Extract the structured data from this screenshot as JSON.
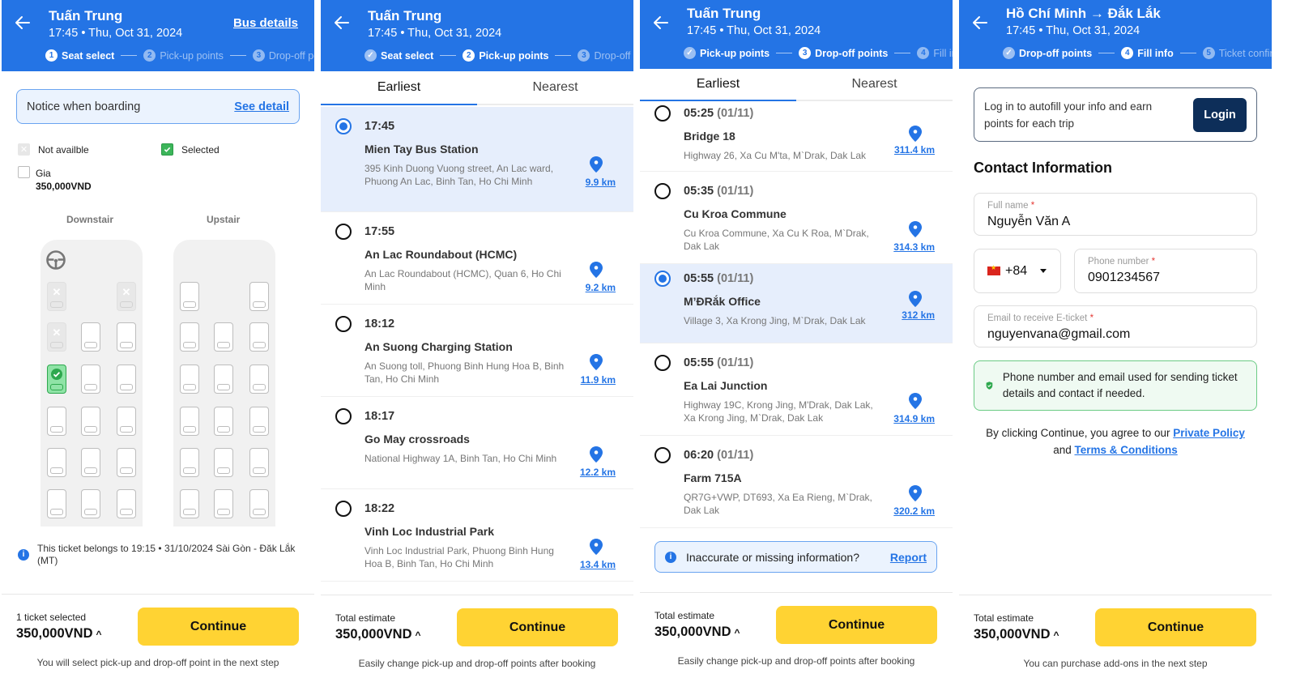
{
  "colors": {
    "brand_blue": "#2474e5",
    "continue_yellow": "#ffd333",
    "login_navy": "#0d2e59",
    "selected_green": "#2ea84e"
  },
  "panel1": {
    "header": {
      "title": "Tuấn Trung",
      "subtitle": "17:45 • Thu, Oct 31, 2024",
      "link": "Bus details"
    },
    "steps": [
      {
        "num": "1",
        "label": "Seat select",
        "state": "active"
      },
      {
        "num": "2",
        "label": "Pick-up points",
        "state": "pending"
      },
      {
        "num": "3",
        "label": "Drop-off points",
        "state": "pending"
      }
    ],
    "notice": {
      "text": "Notice when boarding",
      "link": "See detail"
    },
    "legend": {
      "not_available": "Not availble",
      "selected": "Selected",
      "price_label": "Gia",
      "price": "350,000VND"
    },
    "decks": {
      "downstair": "Downstair",
      "upstair": "Upstair"
    },
    "seat_map": {
      "downstair": [
        [
          "na",
          "",
          "na"
        ],
        [
          "na",
          "free",
          "free"
        ],
        [
          "sel",
          "free",
          "free"
        ],
        [
          "free",
          "free",
          "free"
        ],
        [
          "free",
          "free",
          "free"
        ],
        [
          "free",
          "free",
          "free"
        ]
      ],
      "upstair": [
        [
          "free",
          "",
          "free"
        ],
        [
          "free",
          "free",
          "free"
        ],
        [
          "free",
          "free",
          "free"
        ],
        [
          "free",
          "free",
          "free"
        ],
        [
          "free",
          "free",
          "free"
        ],
        [
          "free",
          "free",
          "free"
        ]
      ]
    },
    "info": "This ticket belongs to 19:15 • 31/10/2024 Sài Gòn - Đăk Lắk (MT)",
    "footer": {
      "label": "1 ticket selected",
      "price": "350,000VND",
      "button": "Continue",
      "note": "You will select pick-up and drop-off point in the next step"
    }
  },
  "panel2": {
    "header": {
      "title": "Tuấn Trung",
      "subtitle": "17:45 • Thu, Oct 31, 2024"
    },
    "steps": [
      {
        "num": "✓",
        "label": "Seat select",
        "state": "done"
      },
      {
        "num": "2",
        "label": "Pick-up points",
        "state": "active"
      },
      {
        "num": "3",
        "label": "Drop-off points",
        "state": "pending"
      }
    ],
    "tabs": [
      "Earliest",
      "Nearest"
    ],
    "stops": [
      {
        "time": "17:45",
        "name": "Mien Tay Bus Station",
        "address": "395 Kinh Duong Vuong street, An Lac ward, Phuong An Lac, Binh Tan, Ho Chi Minh",
        "distance": "9.9 km",
        "selected": true
      },
      {
        "time": "17:55",
        "name": "An Lac Roundabout (HCMC)",
        "address": "An Lac Roundabout (HCMC), Quan 6, Ho Chi Minh",
        "distance": "9.2 km",
        "selected": false
      },
      {
        "time": "18:12",
        "name": "An Suong Charging Station",
        "address": "An Suong toll, Phuong Binh Hung Hoa B, Binh Tan, Ho Chi Minh",
        "distance": "11.9 km",
        "selected": false
      },
      {
        "time": "18:17",
        "name": "Go May crossroads",
        "address": "National Highway 1A, Binh Tan, Ho Chi Minh",
        "distance": "12.2 km",
        "selected": false
      },
      {
        "time": "18:22",
        "name": "Vinh Loc Industrial Park",
        "address": "Vinh Loc Industrial Park, Phuong Binh Hung Hoa B, Binh Tan, Ho Chi Minh",
        "distance": "13.4 km",
        "selected": false
      }
    ],
    "footer": {
      "label": "Total estimate",
      "price": "350,000VND",
      "button": "Continue",
      "note": "Easily change pick-up and drop-off points after booking"
    }
  },
  "panel3": {
    "header": {
      "title": "Tuấn Trung",
      "subtitle": "17:45 • Thu, Oct 31, 2024"
    },
    "steps": [
      {
        "num": "✓",
        "label": "Pick-up points",
        "state": "done"
      },
      {
        "num": "3",
        "label": "Drop-off points",
        "state": "active"
      },
      {
        "num": "4",
        "label": "Fill info",
        "state": "pending"
      }
    ],
    "tabs": [
      "Earliest",
      "Nearest"
    ],
    "stops": [
      {
        "time": "05:25",
        "date": "(01/11)",
        "name": "Bridge 18",
        "address": "Highway 26, Xa Cu M'ta, M`Drak, Dak Lak",
        "distance": "311.4 km",
        "selected": false
      },
      {
        "time": "05:35",
        "date": "(01/11)",
        "name": "Cu Kroa Commune",
        "address": "Cu Kroa Commune, Xa Cu K Roa, M`Drak, Dak Lak",
        "distance": "314.3 km",
        "selected": false
      },
      {
        "time": "05:55",
        "date": "(01/11)",
        "name": "M’ĐRắk Office",
        "address": "Village 3, Xa Krong Jing, M`Drak, Dak Lak",
        "distance": "312 km",
        "selected": true
      },
      {
        "time": "05:55",
        "date": "(01/11)",
        "name": "Ea Lai Junction",
        "address": "Highway 19C, Krong Jing, M'Drak, Dak Lak, Xa Krong Jing, M`Drak, Dak Lak",
        "distance": "314.9 km",
        "selected": false
      },
      {
        "time": "06:20",
        "date": "(01/11)",
        "name": "Farm 715A",
        "address": "QR7G+VWP, DT693, Xa Ea Rieng, M`Drak, Dak Lak",
        "distance": "320.2 km",
        "selected": false
      }
    ],
    "report": {
      "text": "Inaccurate or missing information?",
      "link": "Report"
    },
    "footer": {
      "label": "Total estimate",
      "price": "350,000VND",
      "button": "Continue",
      "note": "Easily change pick-up and drop-off points after booking"
    }
  },
  "panel4": {
    "header": {
      "title": "Hồ Chí Minh → Đắk Lắk",
      "subtitle": "17:45 • Thu, Oct 31, 2024"
    },
    "steps": [
      {
        "num": "✓",
        "label": "Drop-off points",
        "state": "done"
      },
      {
        "num": "4",
        "label": "Fill info",
        "state": "active"
      },
      {
        "num": "5",
        "label": "Ticket confirmation",
        "state": "pending"
      }
    ],
    "login": {
      "text": "Log in to autofill your info and earn points for each trip",
      "button": "Login"
    },
    "contact_title": "Contact Information",
    "fields": {
      "full_name": {
        "label": "Full name",
        "value": "Nguyễn Văn A"
      },
      "country_code": "+84",
      "phone": {
        "label": "Phone number",
        "value": "0901234567"
      },
      "email": {
        "label": "Email to receive E-ticket",
        "value": "nguyenvana@gmail.com"
      },
      "required_mark": "*"
    },
    "privacy_note": "Phone number and email used for sending ticket details and contact if needed.",
    "agree": {
      "prefix": "By clicking Continue, you agree to our ",
      "policy": "Private Policy",
      "and": " and ",
      "terms": "Terms & Conditions"
    },
    "footer": {
      "label": "Total estimate",
      "price": "350,000VND",
      "button": "Continue",
      "note": "You can purchase add-ons in the next step"
    }
  }
}
